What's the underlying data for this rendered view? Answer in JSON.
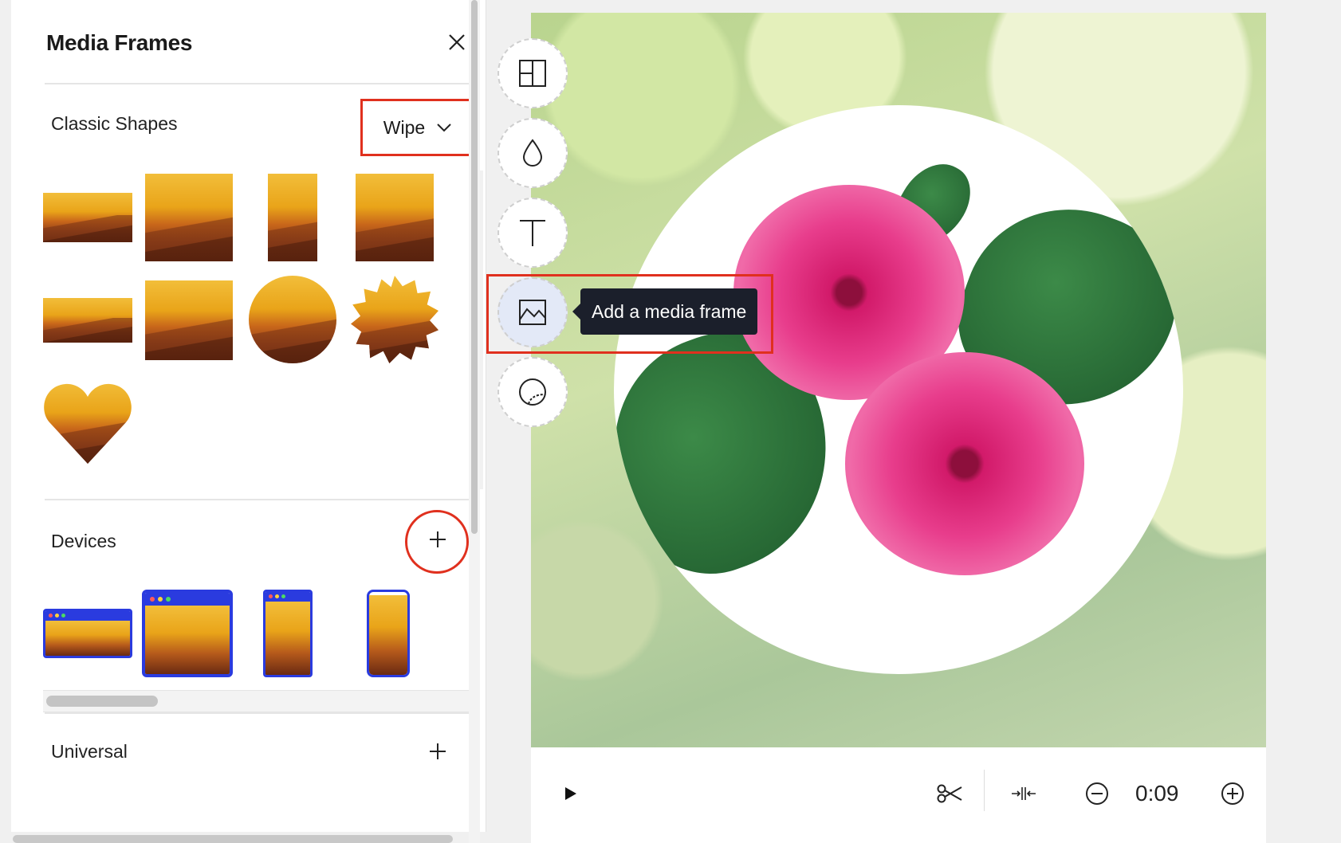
{
  "panel": {
    "title": "Media Frames",
    "sections": {
      "classic": {
        "label": "Classic Shapes",
        "select_value": "Wipe"
      },
      "devices": {
        "label": "Devices"
      },
      "universal": {
        "label": "Universal"
      }
    }
  },
  "tools": {
    "tooltip": "Add a media frame",
    "items": [
      "layout-icon",
      "drop-icon",
      "text-icon",
      "image-frame-icon",
      "sticker-icon"
    ]
  },
  "controls": {
    "time": "0:09"
  },
  "colors": {
    "highlight": "#e0301e",
    "device_blue": "#2a3bdf",
    "tooltip_bg": "#1b1f2b"
  }
}
